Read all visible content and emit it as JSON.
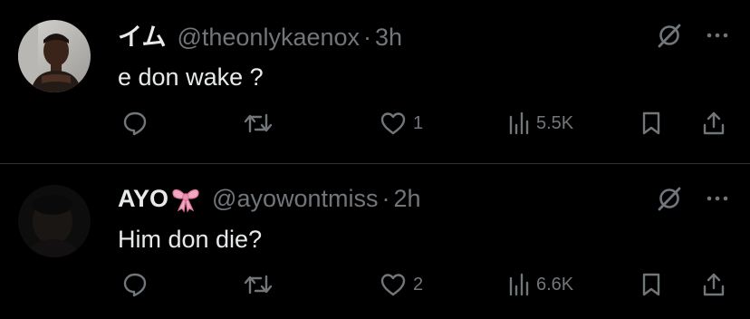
{
  "tweets": [
    {
      "display_name": "イム",
      "display_emoji": "",
      "handle": "@theonlykaenox",
      "separator": "·",
      "time": "3h",
      "text": "e don wake ?",
      "replies": "",
      "reposts": "",
      "likes": "1",
      "views": "5.5K"
    },
    {
      "display_name": "AYO",
      "display_emoji": "ribbon-bow",
      "handle": "@ayowontmiss",
      "separator": "·",
      "time": "2h",
      "text": "Him don die?",
      "replies": "",
      "reposts": "",
      "likes": "2",
      "views": "6.6K"
    }
  ],
  "colors": {
    "background": "#000000",
    "primary_text": "#e7e9ea",
    "secondary_text": "#71767b",
    "divider": "#2f3336",
    "bow": "#f4a7c0"
  },
  "icons": [
    "grok-icon",
    "more-icon",
    "reply-icon",
    "repost-icon",
    "like-icon",
    "views-icon",
    "bookmark-icon",
    "share-icon"
  ]
}
